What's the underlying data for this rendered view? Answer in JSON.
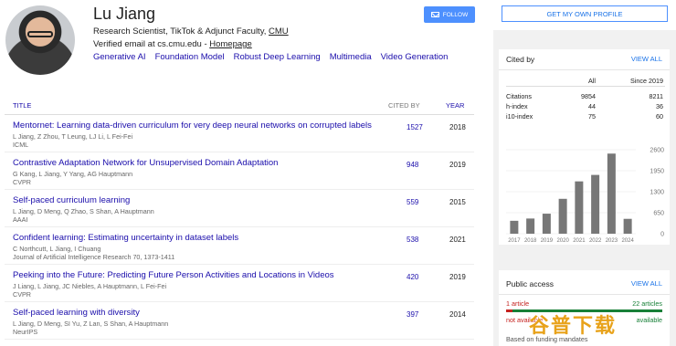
{
  "profile": {
    "name": "Lu Jiang",
    "affiliation_prefix": "Research Scientist, TikTok & Adjunct Faculty, ",
    "affiliation_org": "CMU",
    "verified_prefix": "Verified email at cs.cmu.edu - ",
    "homepage_label": "Homepage",
    "interests": [
      "Generative AI",
      "Foundation Model",
      "Robust Deep Learning",
      "Multimedia",
      "Video Generation"
    ]
  },
  "buttons": {
    "follow": "FOLLOW",
    "get_profile": "GET MY OWN PROFILE"
  },
  "table": {
    "headers": {
      "title": "TITLE",
      "cited_by": "CITED BY",
      "year": "YEAR"
    },
    "rows": [
      {
        "title": "Mentornet: Learning data-driven curriculum for very deep neural networks on corrupted labels",
        "authors": "L Jiang, Z Zhou, T Leung, LJ Li, L Fei-Fei",
        "venue": "ICML",
        "cited": "1527",
        "year": "2018"
      },
      {
        "title": "Contrastive Adaptation Network for Unsupervised Domain Adaptation",
        "authors": "G Kang, L Jiang, Y Yang, AG Hauptmann",
        "venue": "CVPR",
        "cited": "948",
        "year": "2019"
      },
      {
        "title": "Self-paced curriculum learning",
        "authors": "L Jiang, D Meng, Q Zhao, S Shan, A Hauptmann",
        "venue": "AAAI",
        "cited": "559",
        "year": "2015"
      },
      {
        "title": "Confident learning: Estimating uncertainty in dataset labels",
        "authors": "C Northcutt, L Jiang, I Chuang",
        "venue": "Journal of Artificial Intelligence Research 70, 1373-1411",
        "cited": "538",
        "year": "2021"
      },
      {
        "title": "Peeking into the Future: Predicting Future Person Activities and Locations in Videos",
        "authors": "J Liang, L Jiang, JC Niebles, A Hauptmann, L Fei-Fei",
        "venue": "CVPR",
        "cited": "420",
        "year": "2019"
      },
      {
        "title": "Self-paced learning with diversity",
        "authors": "L Jiang, D Meng, SI Yu, Z Lan, S Shan, A Hauptmann",
        "venue": "NeurIPS",
        "cited": "397",
        "year": "2014"
      }
    ]
  },
  "cited_by": {
    "title": "Cited by",
    "view_all": "VIEW ALL",
    "col_all": "All",
    "col_since": "Since 2019",
    "stats": [
      {
        "label": "Citations",
        "all": "9854",
        "since": "8211"
      },
      {
        "label": "h-index",
        "all": "44",
        "since": "36"
      },
      {
        "label": "i10-index",
        "all": "75",
        "since": "60"
      }
    ]
  },
  "chart_data": {
    "type": "bar",
    "categories": [
      "2017",
      "2018",
      "2019",
      "2020",
      "2021",
      "2022",
      "2023",
      "2024"
    ],
    "values": [
      400,
      470,
      620,
      1080,
      1620,
      1820,
      2480,
      460
    ],
    "yticks": [
      "2600",
      "1950",
      "1300",
      "650",
      "0"
    ],
    "ylim": [
      0,
      2600
    ],
    "bar_color": "#777777"
  },
  "public_access": {
    "title": "Public access",
    "view_all": "VIEW ALL",
    "not_available_count": "1 article",
    "available_count": "22 articles",
    "not_available_label": "not available",
    "available_label": "available",
    "not_available_fraction": 0.04,
    "basis": "Based on funding mandates"
  },
  "watermark": {
    "text": "谷普下载"
  }
}
